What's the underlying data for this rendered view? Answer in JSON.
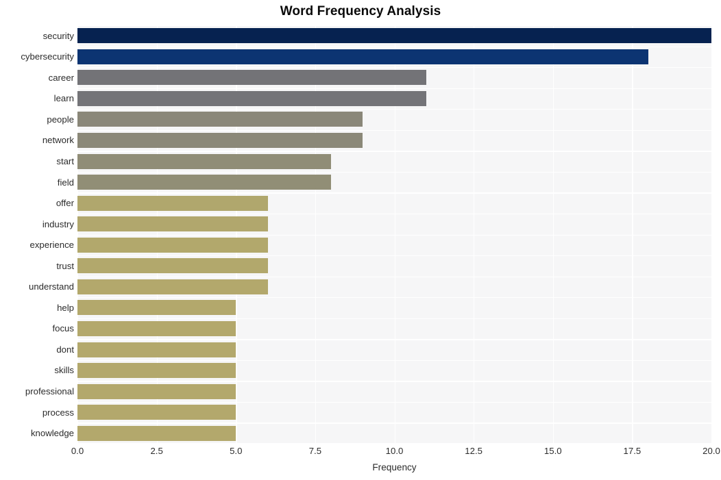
{
  "chart_data": {
    "type": "bar",
    "orientation": "horizontal",
    "title": "Word Frequency Analysis",
    "xlabel": "Frequency",
    "ylabel": "",
    "xlim": [
      0.0,
      20.0
    ],
    "grid": true,
    "legend": null,
    "xticks": [
      "0.0",
      "2.5",
      "5.0",
      "7.5",
      "10.0",
      "12.5",
      "15.0",
      "17.5",
      "20.0"
    ],
    "xtick_values": [
      0.0,
      2.5,
      5.0,
      7.5,
      10.0,
      12.5,
      15.0,
      17.5,
      20.0
    ],
    "categories": [
      "security",
      "cybersecurity",
      "career",
      "learn",
      "people",
      "network",
      "start",
      "field",
      "offer",
      "industry",
      "experience",
      "trust",
      "understand",
      "help",
      "focus",
      "dont",
      "skills",
      "professional",
      "process",
      "knowledge"
    ],
    "values": [
      20,
      18,
      11,
      11,
      9,
      9,
      8,
      8,
      6,
      6,
      6,
      6,
      6,
      5,
      5,
      5,
      5,
      5,
      5,
      5
    ],
    "bar_colors": [
      "#062250",
      "#0c3472",
      "#737377",
      "#747478",
      "#8a8779",
      "#8b8878",
      "#908d77",
      "#918e76",
      "#b0a76d",
      "#b1a76d",
      "#b2a86c",
      "#b2a86c",
      "#b3a86c",
      "#b3a86c",
      "#b3a86c",
      "#b3a86c",
      "#b3a86c",
      "#b3a86c",
      "#b3a86c",
      "#b3a86c"
    ]
  },
  "style": {
    "figure_background": "#ffffff",
    "axes_background": "#f6f6f7",
    "grid_color": "#ffffff",
    "text_color": "#2b2b2b",
    "title_color": "#0a0a0a"
  }
}
